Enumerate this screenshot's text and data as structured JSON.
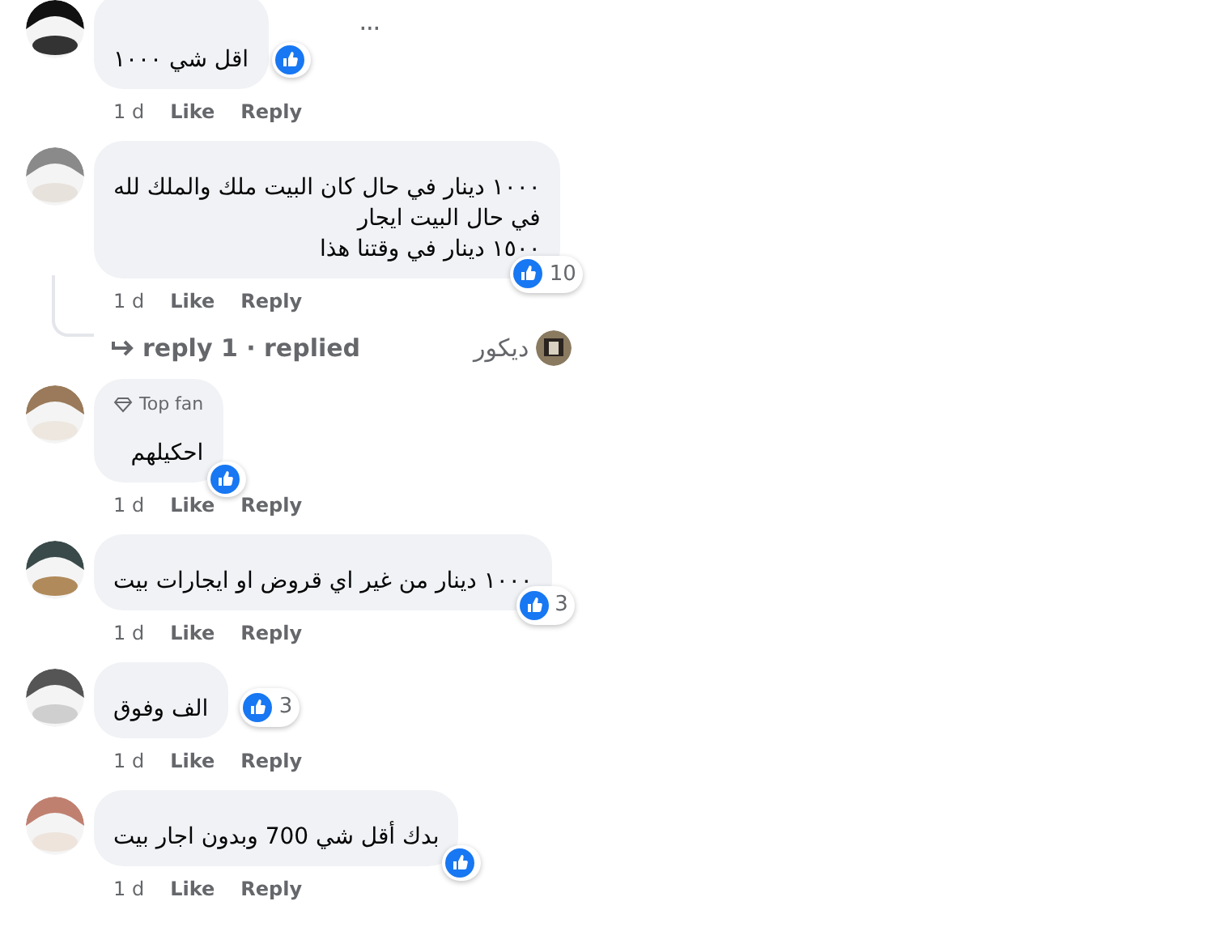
{
  "comments": [
    {
      "lines": [
        "اقل شي ١٠٠٠"
      ],
      "liked": true,
      "reaction_inline": true,
      "time": "1 d",
      "like": "Like",
      "reply": "Reply",
      "menu": "···"
    },
    {
      "lines": [
        "١٠٠٠ دينار في حال كان البيت ملك والملك لله",
        "في حال البيت ايجار",
        "١٥٠٠ دينار في وقتنا هذا"
      ],
      "liked": true,
      "reaction_count": "10",
      "reaction_inline": false,
      "time": "1 d",
      "like": "Like",
      "reply": "Reply",
      "thread": {
        "summary": "reply 1 · replied",
        "author": "ديكور"
      }
    },
    {
      "badge": "Top fan",
      "lines": [
        "احكيلهم"
      ],
      "liked": true,
      "reaction_inline": false,
      "time": "1 d",
      "like": "Like",
      "reply": "Reply"
    },
    {
      "lines": [
        "١٠٠٠ دينار من غير اي قروض او ايجارات بيت"
      ],
      "liked": true,
      "reaction_count": "3",
      "reaction_inline": false,
      "time": "1 d",
      "like": "Like",
      "reply": "Reply"
    },
    {
      "lines": [
        "الف وفوق"
      ],
      "liked": true,
      "reaction_count": "3",
      "reaction_inline": true,
      "time": "1 d",
      "like": "Like",
      "reply": "Reply"
    },
    {
      "lines": [
        "بدك أقل شي 700 وبدون اجار بيت"
      ],
      "liked": true,
      "reaction_inline": false,
      "time": "1 d",
      "like": "Like",
      "reply": "Reply"
    }
  ]
}
